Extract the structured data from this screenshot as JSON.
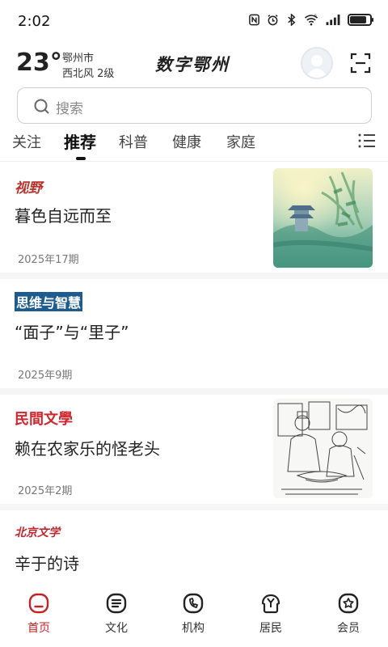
{
  "status_bar": {
    "time": "2:02",
    "battery_level": 0.85,
    "network_badge": "6"
  },
  "header": {
    "temperature": "23°",
    "city": "鄂州市",
    "wind": "西北风  2级",
    "logo_text": "数字鄂州"
  },
  "search": {
    "placeholder": "搜索"
  },
  "tabs": [
    {
      "label": "关注",
      "active": false
    },
    {
      "label": "推荐",
      "active": true
    },
    {
      "label": "科普",
      "active": false
    },
    {
      "label": "健康",
      "active": false
    },
    {
      "label": "家庭",
      "active": false
    }
  ],
  "feed": [
    {
      "source": "视野",
      "source_color": "#b9332a",
      "title": "暮色自远而至",
      "date": "2025年17期",
      "has_image": true
    },
    {
      "source": "思维与智慧",
      "source_color": "#1e5c8f",
      "title": "“面子”与“里子”",
      "date": "2025年9期",
      "has_image": false
    },
    {
      "source": "民間文學",
      "source_color": "#d0262d",
      "title": "赖在农家乐的怪老头",
      "date": "2025年2期",
      "has_image": true
    },
    {
      "source": "北京文学",
      "source_color": "#c2262c",
      "title": "辛于的诗",
      "date": "",
      "has_image": false
    }
  ],
  "bottom_nav": [
    {
      "label": "首页",
      "icon": "home-icon",
      "active": true
    },
    {
      "label": "文化",
      "icon": "culture-icon",
      "active": false
    },
    {
      "label": "机构",
      "icon": "institution-icon",
      "active": false
    },
    {
      "label": "居民",
      "icon": "resident-icon",
      "active": false
    },
    {
      "label": "会员",
      "icon": "member-icon",
      "active": false
    }
  ],
  "colors": {
    "accent": "#c42026",
    "text": "#222222",
    "muted": "#777777"
  }
}
